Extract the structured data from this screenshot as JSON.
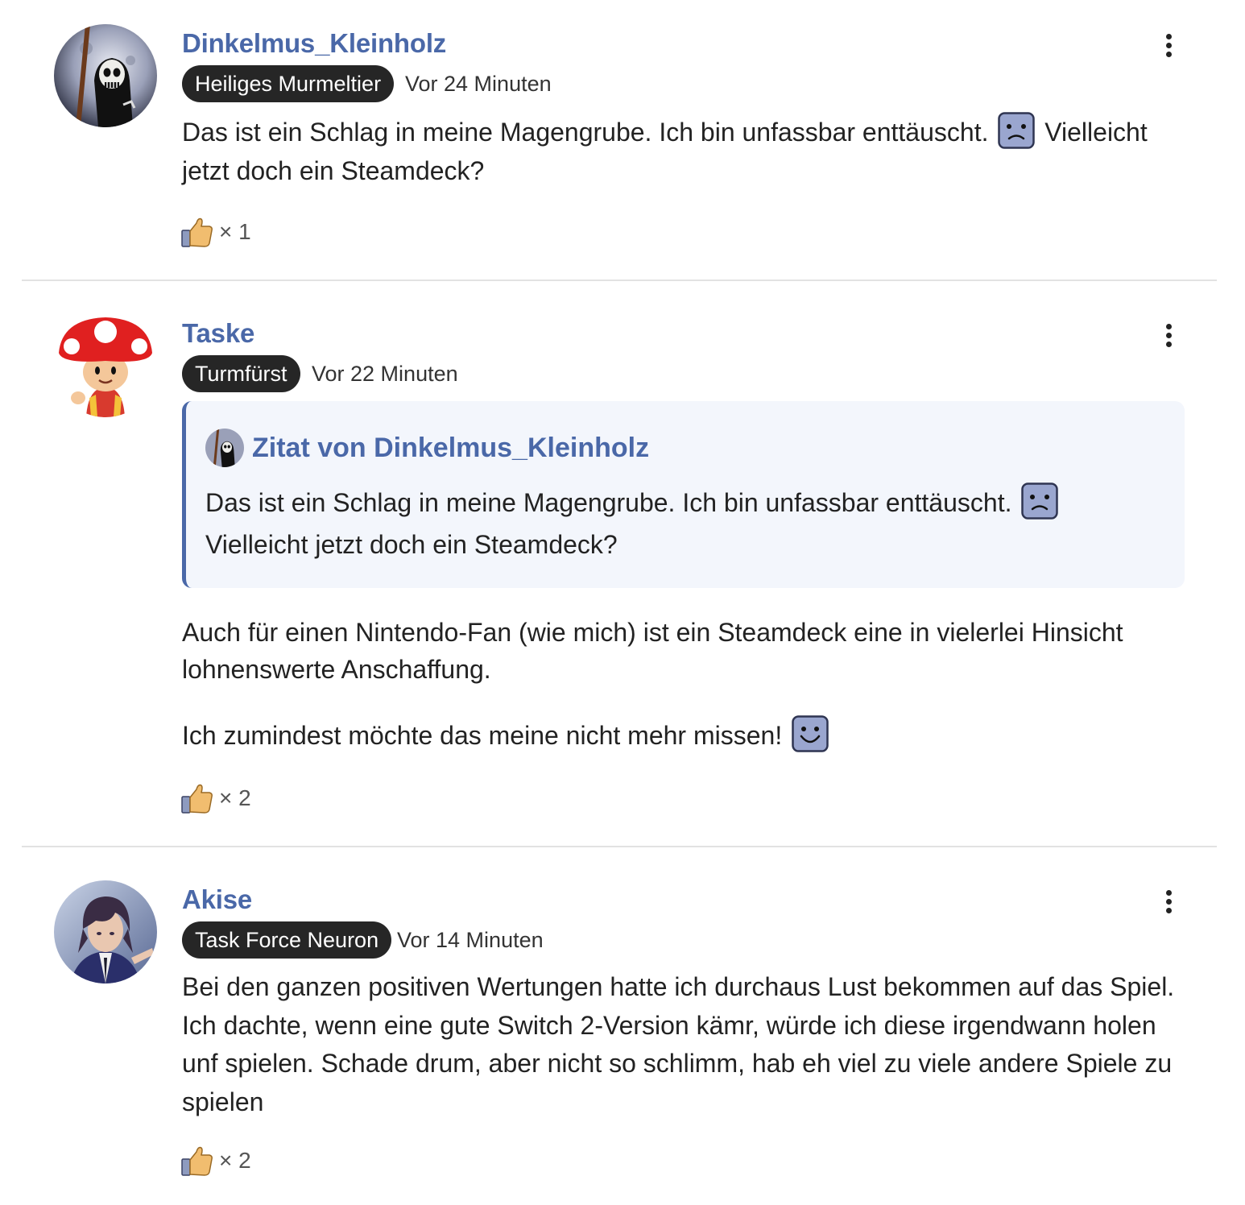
{
  "posts": [
    {
      "author": "Dinkelmus_Kleinholz",
      "rank": "Heiliges Murmeltier",
      "time": "Vor 24 Minuten",
      "text_part1": "Das ist ein Schlag in meine Magengrube. Ich bin unfassbar enttäuscht.",
      "text_part2": "Vielleicht jetzt doch ein Steamdeck?",
      "reaction_count": "1"
    },
    {
      "author": "Taske",
      "rank": "Turmfürst",
      "time": "Vor 22 Minuten",
      "quote": {
        "title": "Zitat von Dinkelmus_Kleinholz",
        "text_part1": "Das ist ein Schlag in meine Magengrube. Ich bin unfassbar enttäuscht.",
        "text_part2": "Vielleicht jetzt doch ein Steamdeck?"
      },
      "paragraph1": "Auch für einen Nintendo-Fan (wie mich) ist ein Steamdeck eine in vielerlei Hinsicht lohnenswerte Anschaffung.",
      "paragraph2": "Ich zumindest möchte das meine nicht mehr missen!",
      "reaction_count": "2"
    },
    {
      "author": "Akise",
      "rank": "Task Force Neuron",
      "time": "Vor 14 Minuten",
      "text": "Bei den ganzen positiven Wertungen hatte ich durchaus Lust bekommen auf das Spiel. Ich dachte, wenn eine gute Switch 2-Version kämr, würde ich diese irgendwann holen unf spielen. Schade drum, aber nicht so schlimm, hab eh viel zu viele andere Spiele zu spielen",
      "reaction_count": "2"
    }
  ],
  "reaction_prefix": "×",
  "icons": {
    "menu": "more-vertical-icon",
    "reaction": "thumbs-up-icon",
    "sad": "sad-smiley-icon",
    "happy": "happy-smiley-icon"
  },
  "colors": {
    "author": "#4a68a8",
    "badge_bg": "#262626",
    "quote_bg": "#f3f6fc",
    "quote_border": "#4a68a8",
    "smiley_fill": "#9aa6cf"
  }
}
